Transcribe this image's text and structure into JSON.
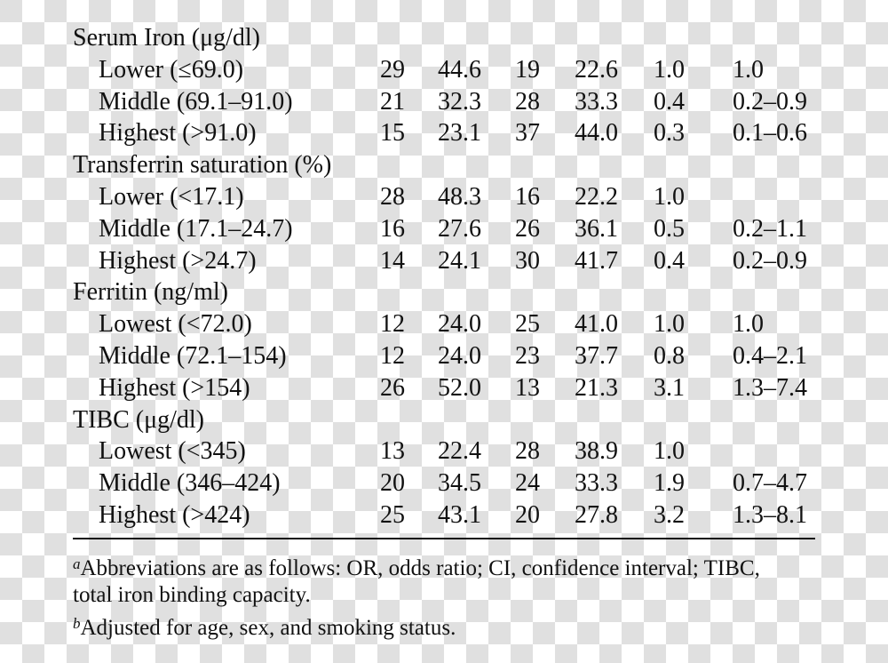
{
  "groups": [
    {
      "title": "Serum Iron (μg/dl)",
      "rows": [
        {
          "label": "Lower (≤69.0)",
          "v": [
            "29",
            "44.6",
            "19",
            "22.6",
            "1.0",
            "1.0"
          ]
        },
        {
          "label": "Middle (69.1–91.0)",
          "v": [
            "21",
            "32.3",
            "28",
            "33.3",
            "0.4",
            "0.2–0.9"
          ]
        },
        {
          "label": "Highest (>91.0)",
          "v": [
            "15",
            "23.1",
            "37",
            "44.0",
            "0.3",
            "0.1–0.6"
          ]
        }
      ]
    },
    {
      "title": "Transferrin saturation (%)",
      "rows": [
        {
          "label": "Lower (<17.1)",
          "v": [
            "28",
            "48.3",
            "16",
            "22.2",
            "1.0",
            ""
          ]
        },
        {
          "label": "Middle (17.1–24.7)",
          "v": [
            "16",
            "27.6",
            "26",
            "36.1",
            "0.5",
            "0.2–1.1"
          ]
        },
        {
          "label": "Highest (>24.7)",
          "v": [
            "14",
            "24.1",
            "30",
            "41.7",
            "0.4",
            "0.2–0.9"
          ]
        }
      ]
    },
    {
      "title": "Ferritin (ng/ml)",
      "rows": [
        {
          "label": "Lowest (<72.0)",
          "v": [
            "12",
            "24.0",
            "25",
            "41.0",
            "1.0",
            "1.0"
          ]
        },
        {
          "label": "Middle (72.1–154)",
          "v": [
            "12",
            "24.0",
            "23",
            "37.7",
            "0.8",
            "0.4–2.1"
          ]
        },
        {
          "label": "Highest (>154)",
          "v": [
            "26",
            "52.0",
            "13",
            "21.3",
            "3.1",
            "1.3–7.4"
          ]
        }
      ]
    },
    {
      "title": "TIBC (μg/dl)",
      "rows": [
        {
          "label": "Lowest (<345)",
          "v": [
            "13",
            "22.4",
            "28",
            "38.9",
            "1.0",
            ""
          ]
        },
        {
          "label": "Middle (346–424)",
          "v": [
            "20",
            "34.5",
            "24",
            "33.3",
            "1.9",
            "0.7–4.7"
          ]
        },
        {
          "label": "Highest (>424)",
          "v": [
            "25",
            "43.1",
            "20",
            "27.8",
            "3.2",
            "1.3–8.1"
          ]
        }
      ]
    }
  ],
  "footnotes": {
    "a_mark": "a",
    "a_line1": "Abbreviations are as follows: OR, odds ratio; CI, confidence interval; TIBC,",
    "a_line2": "total iron binding capacity.",
    "b_mark": "b",
    "b_line1": "Adjusted for age, sex, and smoking status."
  }
}
